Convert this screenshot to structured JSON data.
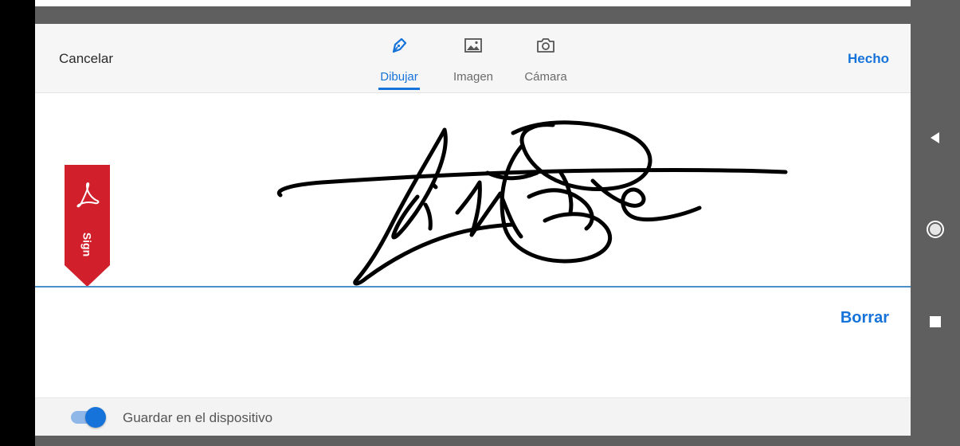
{
  "header": {
    "cancel_label": "Cancelar",
    "done_label": "Hecho",
    "tabs": [
      {
        "label": "Dibujar",
        "icon": "pen-icon",
        "active": true
      },
      {
        "label": "Imagen",
        "icon": "image-icon",
        "active": false
      },
      {
        "label": "Cámara",
        "icon": "camera-icon",
        "active": false
      }
    ]
  },
  "canvas": {
    "badge_label": "Sign",
    "badge_icon": "acrobat-logo-icon",
    "clear_label": "Borrar"
  },
  "footer": {
    "save_label": "Guardar en el dispositivo",
    "save_enabled": true
  },
  "colors": {
    "accent": "#1673d9",
    "badge": "#d1202b",
    "ink": "#000000"
  },
  "system_nav": [
    "back-icon",
    "home-icon",
    "recents-icon"
  ]
}
